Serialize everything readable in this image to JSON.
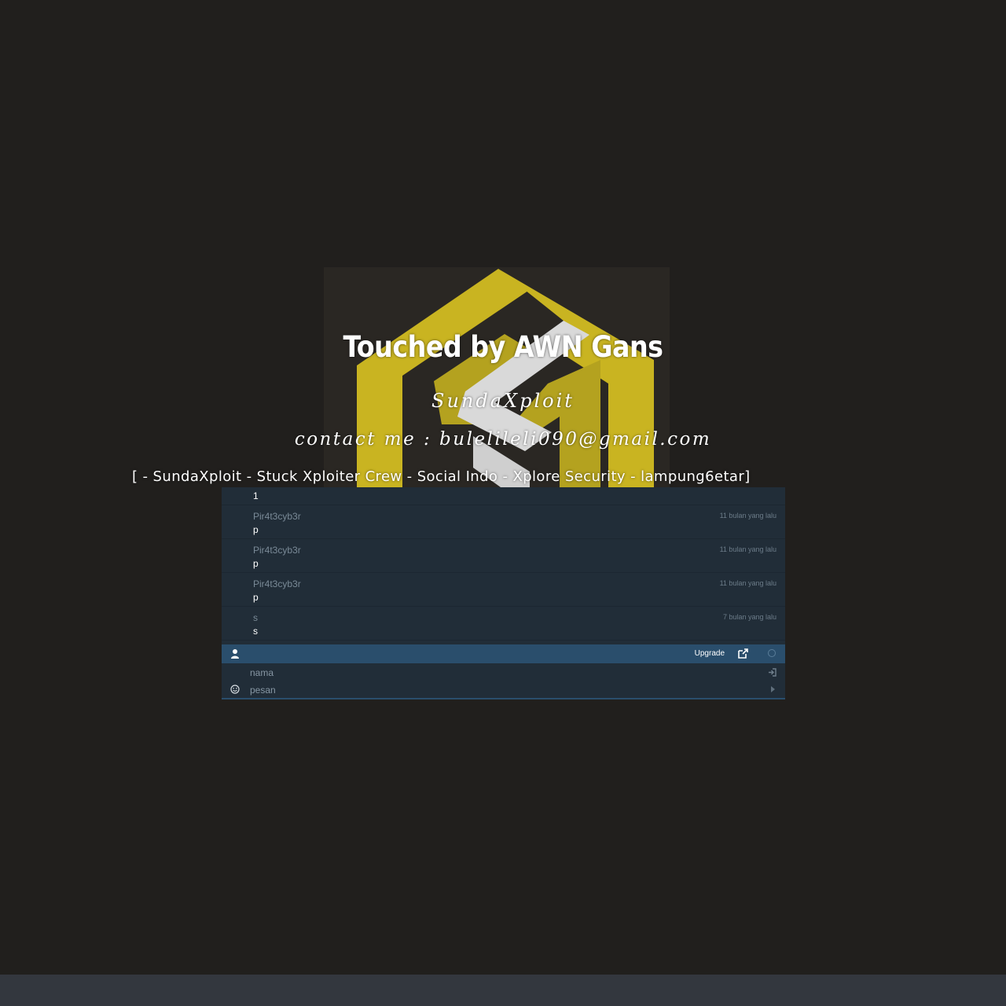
{
  "header": {
    "title": "Touched by AWN Gans",
    "subtitle": "SundaXploit",
    "contact": "contact me : bulelileli090@gmail.com",
    "crew": "[ - SundaXploit - Stuck Xploiter Crew - Social Indo - Xplore Security - lampung6etar]"
  },
  "colors": {
    "background": "#211f1d",
    "logo_yellow": "#c9b421",
    "logo_white": "#d9d9d9",
    "chat_background": "#212d38",
    "chat_toolbar": "#2a4e6c",
    "bottom_bar": "#33373e"
  },
  "chat": {
    "messages": [
      {
        "author": "",
        "time": "",
        "text": "1"
      },
      {
        "author": "Pir4t3cyb3r",
        "time": "11 bulan yang lalu",
        "text": "p"
      },
      {
        "author": "Pir4t3cyb3r",
        "time": "11 bulan yang lalu",
        "text": "p"
      },
      {
        "author": "Pir4t3cyb3r",
        "time": "11 bulan yang lalu",
        "text": "p"
      },
      {
        "author": "s",
        "time": "7 bulan yang lalu",
        "text": "s"
      }
    ],
    "toolbar": {
      "user_icon": "user-icon",
      "upgrade_label": "Upgrade",
      "popout_icon": "external-link-icon",
      "status_icon": "status-circle-icon"
    },
    "form": {
      "name_placeholder": "nama",
      "message_placeholder": "pesan",
      "login_icon": "sign-in-icon",
      "emoji_icon": "smile-icon",
      "send_icon": "caret-right-icon"
    }
  }
}
